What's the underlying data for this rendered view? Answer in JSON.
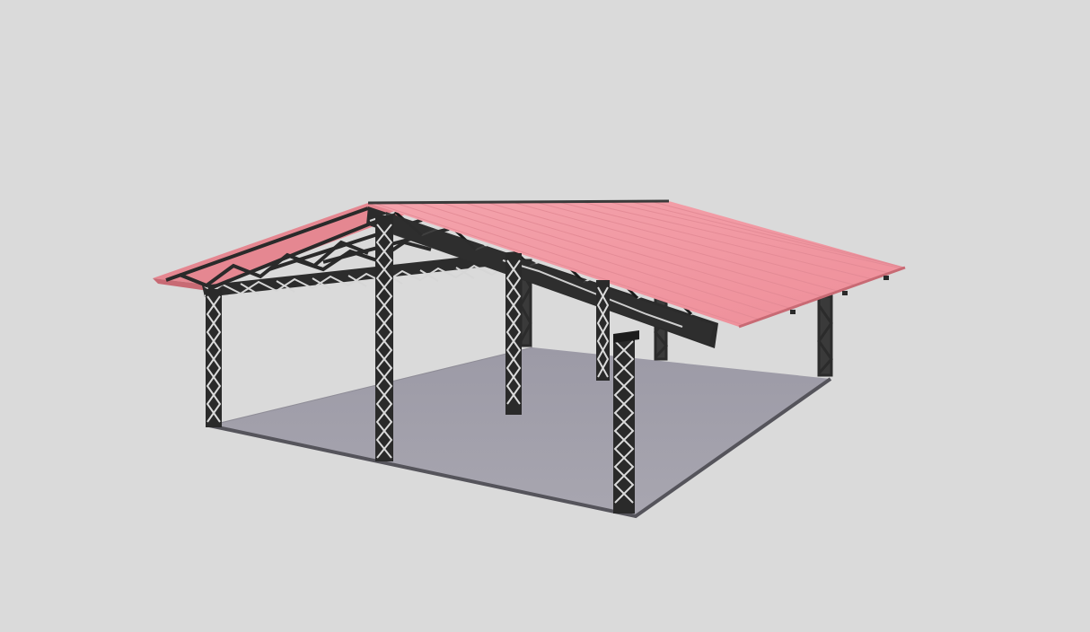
{
  "scene": {
    "subject": "steel-truss-pavilion",
    "colors": {
      "background": "#dadada",
      "floor": "#a3a1ab",
      "floor_edge": "#55545b",
      "roof": "#f0959f",
      "roof_light": "#f4a3ac",
      "roof_rib": "#d97f89",
      "truss": "#2f2f2f",
      "truss_dark": "#1c1c1c"
    }
  }
}
